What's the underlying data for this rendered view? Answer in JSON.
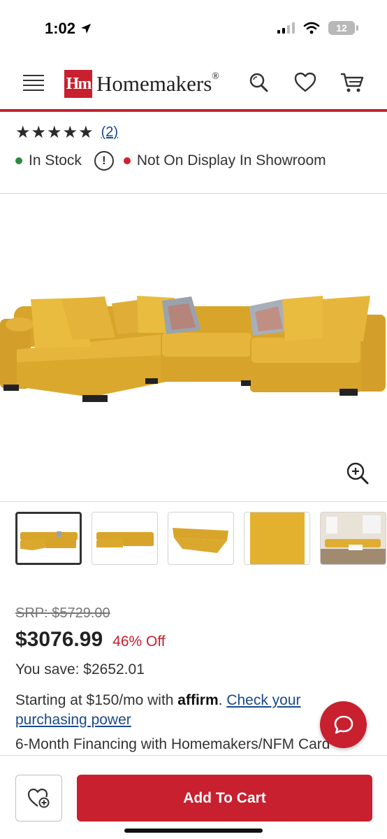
{
  "status_bar": {
    "time": "1:02",
    "battery": "12"
  },
  "header": {
    "logo_mark": "Hm",
    "logo_text": "Homemakers",
    "logo_suffix": "®"
  },
  "product": {
    "stars": "★★★★★",
    "review_count": "(2)",
    "stock_status": "In Stock",
    "display_status": "Not On Display In Showroom",
    "thumbnail_count": 5
  },
  "pricing": {
    "srp": "SRP: $5729.00",
    "price": "$3076.99",
    "discount": "46% Off",
    "savings": "You save: $2652.01",
    "financing_prefix": "Starting at $150/mo with ",
    "affirm": "affirm",
    "financing_link": "Check your purchasing power",
    "financing_2": "6-Month Financing with Homemakers/NFM Card"
  },
  "actions": {
    "add_to_cart": "Add To Cart"
  },
  "colors": {
    "brand_red": "#c8202f",
    "sofa_yellow": "#e8b83a",
    "link_blue": "#1a4a8a"
  }
}
